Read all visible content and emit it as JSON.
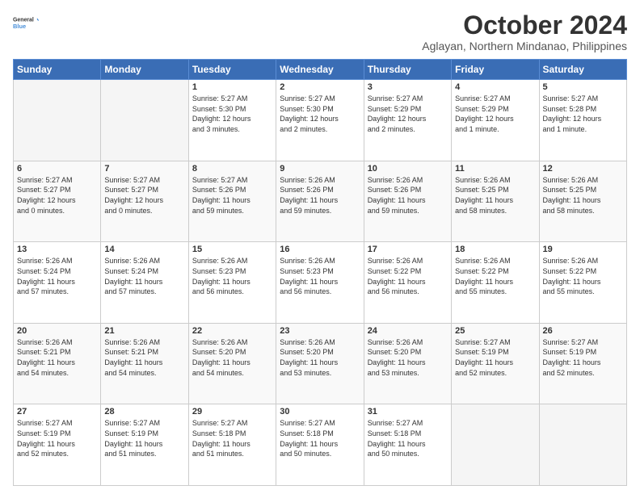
{
  "header": {
    "logo_line1": "General",
    "logo_line2": "Blue",
    "title": "October 2024",
    "subtitle": "Aglayan, Northern Mindanao, Philippines"
  },
  "days_of_week": [
    "Sunday",
    "Monday",
    "Tuesday",
    "Wednesday",
    "Thursday",
    "Friday",
    "Saturday"
  ],
  "weeks": [
    [
      {
        "day": "",
        "info": ""
      },
      {
        "day": "",
        "info": ""
      },
      {
        "day": "1",
        "info": "Sunrise: 5:27 AM\nSunset: 5:30 PM\nDaylight: 12 hours\nand 3 minutes."
      },
      {
        "day": "2",
        "info": "Sunrise: 5:27 AM\nSunset: 5:30 PM\nDaylight: 12 hours\nand 2 minutes."
      },
      {
        "day": "3",
        "info": "Sunrise: 5:27 AM\nSunset: 5:29 PM\nDaylight: 12 hours\nand 2 minutes."
      },
      {
        "day": "4",
        "info": "Sunrise: 5:27 AM\nSunset: 5:29 PM\nDaylight: 12 hours\nand 1 minute."
      },
      {
        "day": "5",
        "info": "Sunrise: 5:27 AM\nSunset: 5:28 PM\nDaylight: 12 hours\nand 1 minute."
      }
    ],
    [
      {
        "day": "6",
        "info": "Sunrise: 5:27 AM\nSunset: 5:27 PM\nDaylight: 12 hours\nand 0 minutes."
      },
      {
        "day": "7",
        "info": "Sunrise: 5:27 AM\nSunset: 5:27 PM\nDaylight: 12 hours\nand 0 minutes."
      },
      {
        "day": "8",
        "info": "Sunrise: 5:27 AM\nSunset: 5:26 PM\nDaylight: 11 hours\nand 59 minutes."
      },
      {
        "day": "9",
        "info": "Sunrise: 5:26 AM\nSunset: 5:26 PM\nDaylight: 11 hours\nand 59 minutes."
      },
      {
        "day": "10",
        "info": "Sunrise: 5:26 AM\nSunset: 5:26 PM\nDaylight: 11 hours\nand 59 minutes."
      },
      {
        "day": "11",
        "info": "Sunrise: 5:26 AM\nSunset: 5:25 PM\nDaylight: 11 hours\nand 58 minutes."
      },
      {
        "day": "12",
        "info": "Sunrise: 5:26 AM\nSunset: 5:25 PM\nDaylight: 11 hours\nand 58 minutes."
      }
    ],
    [
      {
        "day": "13",
        "info": "Sunrise: 5:26 AM\nSunset: 5:24 PM\nDaylight: 11 hours\nand 57 minutes."
      },
      {
        "day": "14",
        "info": "Sunrise: 5:26 AM\nSunset: 5:24 PM\nDaylight: 11 hours\nand 57 minutes."
      },
      {
        "day": "15",
        "info": "Sunrise: 5:26 AM\nSunset: 5:23 PM\nDaylight: 11 hours\nand 56 minutes."
      },
      {
        "day": "16",
        "info": "Sunrise: 5:26 AM\nSunset: 5:23 PM\nDaylight: 11 hours\nand 56 minutes."
      },
      {
        "day": "17",
        "info": "Sunrise: 5:26 AM\nSunset: 5:22 PM\nDaylight: 11 hours\nand 56 minutes."
      },
      {
        "day": "18",
        "info": "Sunrise: 5:26 AM\nSunset: 5:22 PM\nDaylight: 11 hours\nand 55 minutes."
      },
      {
        "day": "19",
        "info": "Sunrise: 5:26 AM\nSunset: 5:22 PM\nDaylight: 11 hours\nand 55 minutes."
      }
    ],
    [
      {
        "day": "20",
        "info": "Sunrise: 5:26 AM\nSunset: 5:21 PM\nDaylight: 11 hours\nand 54 minutes."
      },
      {
        "day": "21",
        "info": "Sunrise: 5:26 AM\nSunset: 5:21 PM\nDaylight: 11 hours\nand 54 minutes."
      },
      {
        "day": "22",
        "info": "Sunrise: 5:26 AM\nSunset: 5:20 PM\nDaylight: 11 hours\nand 54 minutes."
      },
      {
        "day": "23",
        "info": "Sunrise: 5:26 AM\nSunset: 5:20 PM\nDaylight: 11 hours\nand 53 minutes."
      },
      {
        "day": "24",
        "info": "Sunrise: 5:26 AM\nSunset: 5:20 PM\nDaylight: 11 hours\nand 53 minutes."
      },
      {
        "day": "25",
        "info": "Sunrise: 5:27 AM\nSunset: 5:19 PM\nDaylight: 11 hours\nand 52 minutes."
      },
      {
        "day": "26",
        "info": "Sunrise: 5:27 AM\nSunset: 5:19 PM\nDaylight: 11 hours\nand 52 minutes."
      }
    ],
    [
      {
        "day": "27",
        "info": "Sunrise: 5:27 AM\nSunset: 5:19 PM\nDaylight: 11 hours\nand 52 minutes."
      },
      {
        "day": "28",
        "info": "Sunrise: 5:27 AM\nSunset: 5:19 PM\nDaylight: 11 hours\nand 51 minutes."
      },
      {
        "day": "29",
        "info": "Sunrise: 5:27 AM\nSunset: 5:18 PM\nDaylight: 11 hours\nand 51 minutes."
      },
      {
        "day": "30",
        "info": "Sunrise: 5:27 AM\nSunset: 5:18 PM\nDaylight: 11 hours\nand 50 minutes."
      },
      {
        "day": "31",
        "info": "Sunrise: 5:27 AM\nSunset: 5:18 PM\nDaylight: 11 hours\nand 50 minutes."
      },
      {
        "day": "",
        "info": ""
      },
      {
        "day": "",
        "info": ""
      }
    ]
  ]
}
